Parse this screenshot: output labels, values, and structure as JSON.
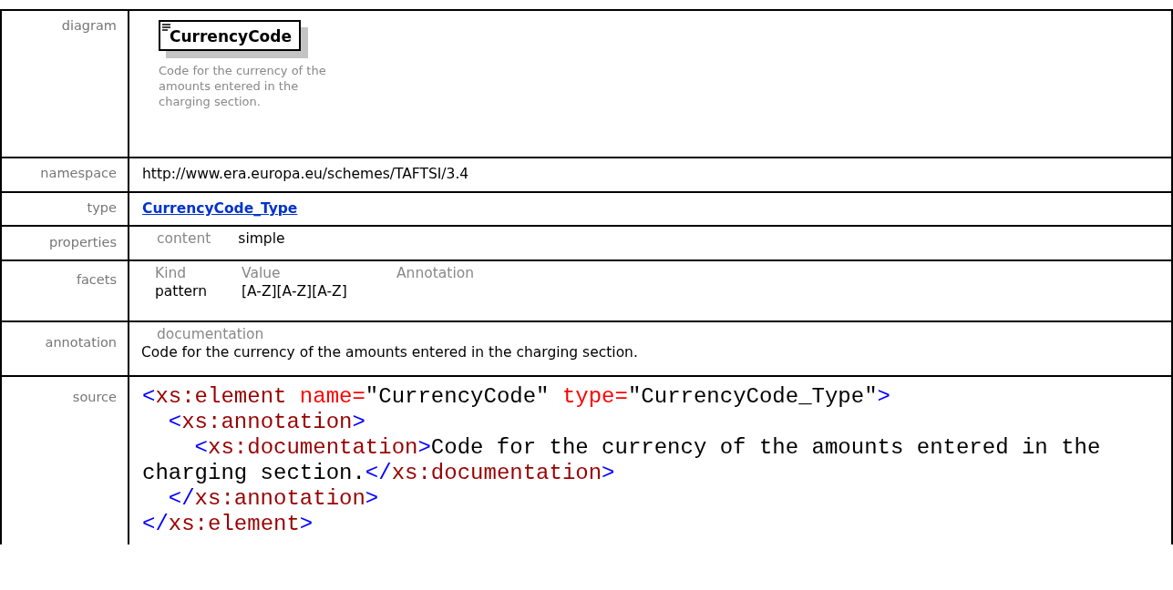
{
  "rows": [
    {
      "label": "diagram",
      "kind": "diagram",
      "element_name": "CurrencyCode",
      "description": "Code for the currency of the amounts entered in the charging section."
    },
    {
      "label": "namespace",
      "kind": "text",
      "value": "http://www.era.europa.eu/schemes/TAFTSI/3.4"
    },
    {
      "label": "type",
      "kind": "link",
      "value": "CurrencyCode_Type"
    },
    {
      "label": "properties",
      "kind": "props",
      "items": [
        {
          "name": "content",
          "value": "simple"
        }
      ]
    },
    {
      "label": "facets",
      "kind": "facets",
      "columns": [
        "Kind",
        "Value",
        "Annotation"
      ],
      "rows": [
        [
          "pattern",
          "[A-Z][A-Z][A-Z]"
        ]
      ]
    },
    {
      "label": "annotation",
      "kind": "annotation",
      "heading": "documentation",
      "text": "Code for the currency of the amounts entered in the charging section."
    },
    {
      "label": "source",
      "kind": "source",
      "lines": [
        [
          {
            "punct": "<"
          },
          {
            "tag": "xs:element"
          },
          {
            "attr": " name="
          },
          {
            "value": "\"CurrencyCode\""
          },
          {
            "attr": " type="
          },
          {
            "value": "\"CurrencyCode_Type\""
          },
          {
            "punct": ">"
          }
        ],
        [
          {
            "punct": "  <"
          },
          {
            "tag": "xs:annotation"
          },
          {
            "punct": ">"
          }
        ],
        [
          {
            "punct": "    <"
          },
          {
            "tag": "xs:documentation"
          },
          {
            "punct": ">"
          },
          {
            "text": "Code for the currency of the amounts entered in the"
          }
        ],
        [
          {
            "text": "charging section."
          },
          {
            "punct": "</"
          },
          {
            "tag": "xs:documentation"
          },
          {
            "punct": ">"
          }
        ],
        [
          {
            "punct": "  </"
          },
          {
            "tag": "xs:annotation"
          },
          {
            "punct": ">"
          }
        ],
        [
          {
            "punct": "</"
          },
          {
            "tag": "xs:element"
          },
          {
            "punct": ">"
          }
        ]
      ]
    }
  ]
}
